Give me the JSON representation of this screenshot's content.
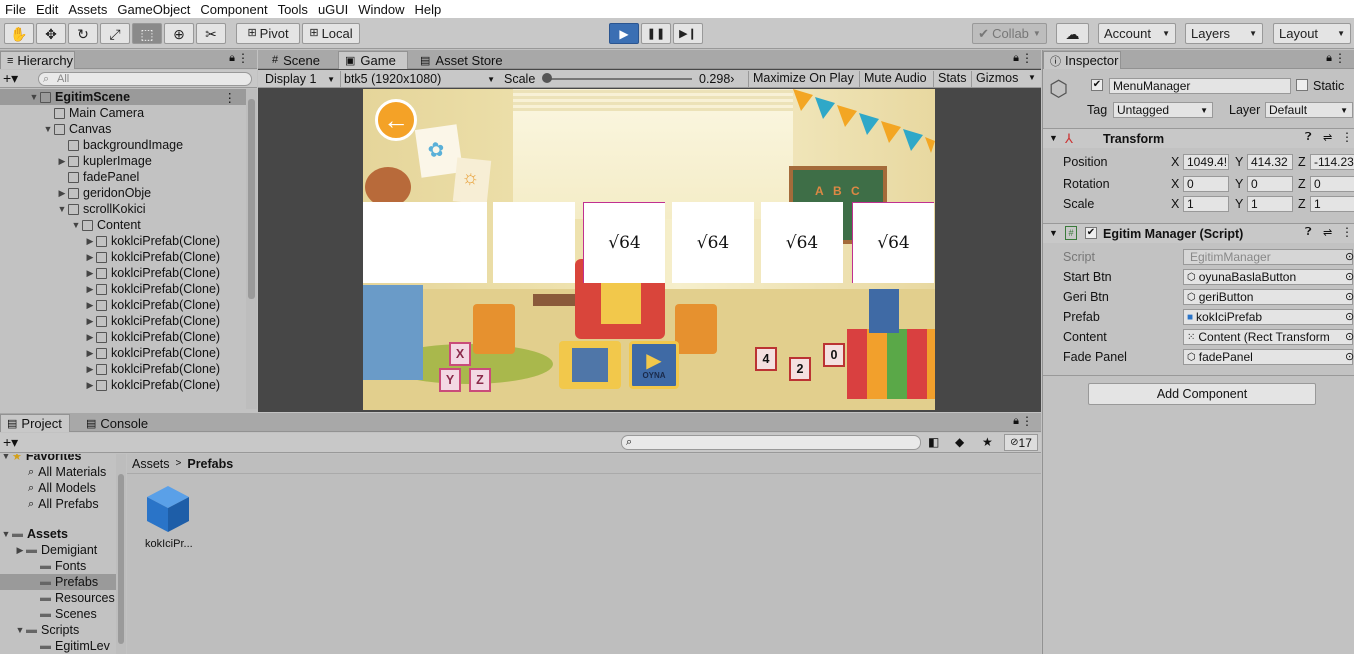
{
  "menu": [
    "File",
    "Edit",
    "Assets",
    "GameObject",
    "Component",
    "Tools",
    "uGUI",
    "Window",
    "Help"
  ],
  "toolbar": {
    "pivot": "Pivot",
    "local": "Local",
    "collab": "Collab",
    "account": "Account",
    "layers": "Layers",
    "layout": "Layout"
  },
  "hierarchy": {
    "tab": "Hierarchy",
    "search_placeholder": "All",
    "items": [
      {
        "label": "EgitimScene",
        "depth": 0,
        "arrow": "▼"
      },
      {
        "label": "Main Camera",
        "depth": 1,
        "arrow": ""
      },
      {
        "label": "Canvas",
        "depth": 1,
        "arrow": "▼"
      },
      {
        "label": "backgroundImage",
        "depth": 2,
        "arrow": ""
      },
      {
        "label": "kuplerImage",
        "depth": 2,
        "arrow": "▶"
      },
      {
        "label": "fadePanel",
        "depth": 2,
        "arrow": ""
      },
      {
        "label": "geridonObje",
        "depth": 2,
        "arrow": "▶"
      },
      {
        "label": "scrollKokici",
        "depth": 2,
        "arrow": "▼"
      },
      {
        "label": "Content",
        "depth": 3,
        "arrow": "▼"
      },
      {
        "label": "koklciPrefab(Clone)",
        "depth": 4,
        "arrow": "▶"
      },
      {
        "label": "koklciPrefab(Clone)",
        "depth": 4,
        "arrow": "▶"
      },
      {
        "label": "koklciPrefab(Clone)",
        "depth": 4,
        "arrow": "▶"
      },
      {
        "label": "koklciPrefab(Clone)",
        "depth": 4,
        "arrow": "▶"
      },
      {
        "label": "koklciPrefab(Clone)",
        "depth": 4,
        "arrow": "▶"
      },
      {
        "label": "koklciPrefab(Clone)",
        "depth": 4,
        "arrow": "▶"
      },
      {
        "label": "koklciPrefab(Clone)",
        "depth": 4,
        "arrow": "▶"
      },
      {
        "label": "koklciPrefab(Clone)",
        "depth": 4,
        "arrow": "▶"
      },
      {
        "label": "koklciPrefab(Clone)",
        "depth": 4,
        "arrow": "▶"
      },
      {
        "label": "koklciPrefab(Clone)",
        "depth": 4,
        "arrow": "▶"
      }
    ]
  },
  "game": {
    "tabs": [
      "Scene",
      "Game",
      "Asset Store"
    ],
    "display": "Display 1",
    "resolution": "btk5 (1920x1080)",
    "scale_label": "Scale",
    "scale_value": "0.298",
    "maximize": "Maximize On Play",
    "mute": "Mute Audio",
    "stats": "Stats",
    "gizmos": "Gizmos",
    "cards": [
      "",
      "",
      "",
      "√64",
      "√64",
      "√64",
      "√64"
    ],
    "play_label": "OYNA",
    "block_letters": [
      "X",
      "Y",
      "Z"
    ],
    "block_numbers": [
      "4",
      "2",
      "0"
    ],
    "abc": [
      "A",
      "B",
      "C"
    ]
  },
  "inspector": {
    "tab": "Inspector",
    "object_name": "MenuManager",
    "static": "Static",
    "tag_label": "Tag",
    "tag_value": "Untagged",
    "layer_label": "Layer",
    "layer_value": "Default",
    "transform": {
      "title": "Transform",
      "position": "Position",
      "rotation": "Rotation",
      "scale": "Scale",
      "pos": [
        "1049.4!",
        "414.32",
        "-114.23"
      ],
      "rot": [
        "0",
        "0",
        "0"
      ],
      "scl": [
        "1",
        "1",
        "1"
      ]
    },
    "script": {
      "title": "Egitim Manager (Script)",
      "fields": [
        {
          "label": "Script",
          "value": "EgitimManager"
        },
        {
          "label": "Start Btn",
          "value": "oyunaBaslaButton"
        },
        {
          "label": "Geri Btn",
          "value": "geriButton"
        },
        {
          "label": "Prefab",
          "value": "kokIciPrefab"
        },
        {
          "label": "Content",
          "value": "Content (Rect Transform"
        },
        {
          "label": "Fade Panel",
          "value": "fadePanel"
        }
      ]
    },
    "add_component": "Add Component"
  },
  "project": {
    "tabs": [
      "Project",
      "Console"
    ],
    "hidden_count": "17",
    "breadcrumb_root": "Assets",
    "breadcrumb_current": "Prefabs",
    "favorites_title": "Favorites",
    "favorites": [
      "All Materials",
      "All Models",
      "All Prefabs"
    ],
    "assets_title": "Assets",
    "folders": [
      "Demigiant",
      "Fonts",
      "Prefabs",
      "Resources",
      "Scenes",
      "Scripts",
      "EgitimLev"
    ],
    "asset_item": "kokIciPr..."
  }
}
